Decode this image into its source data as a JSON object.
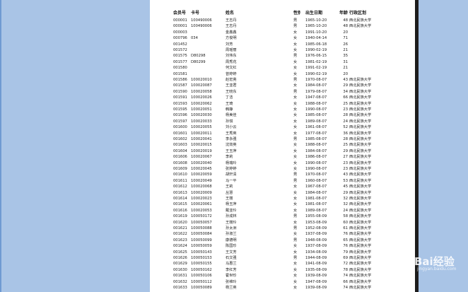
{
  "table": {
    "headers": {
      "id": "会员号",
      "card": "卡号",
      "name": "姓名",
      "gender": "性别",
      "dob": "出生日期",
      "age": "年龄",
      "division": "行政区划"
    },
    "rows": [
      {
        "id": "000001",
        "card": "100490006",
        "name": "王志丹",
        "gender": "男",
        "dob": "1965-10-20",
        "age": "48",
        "division": "西北民族大学"
      },
      {
        "id": "000001",
        "card": "100490006",
        "name": "王志丹",
        "gender": "男",
        "dob": "1965-10-20",
        "age": "48",
        "division": "西北民族大学"
      },
      {
        "id": "000003",
        "card": "",
        "name": "金鑫鑫",
        "gender": "女",
        "dob": "1991-10-20",
        "age": "20",
        "division": ""
      },
      {
        "id": "000796",
        "card": "034",
        "name": "方俊明",
        "gender": "女",
        "dob": "1940-04-14",
        "age": "71",
        "division": ""
      },
      {
        "id": "001452",
        "card": "",
        "name": "刘芳",
        "gender": "女",
        "dob": "1985-06-18",
        "age": "26",
        "division": ""
      },
      {
        "id": "001572",
        "card": "",
        "name": "周瑶丽",
        "gender": "女",
        "dob": "1990-02-19",
        "age": "21",
        "division": ""
      },
      {
        "id": "001575",
        "card": "D80298",
        "name": "刘伟东",
        "gender": "男",
        "dob": "1976-06-15",
        "age": "35",
        "division": ""
      },
      {
        "id": "001577",
        "card": "D80299",
        "name": "周秀花",
        "gender": "女",
        "dob": "1981-02-19",
        "age": "31",
        "division": ""
      },
      {
        "id": "001580",
        "card": "",
        "name": "何文红",
        "gender": "女",
        "dob": "1991-02-19",
        "age": "21",
        "division": ""
      },
      {
        "id": "001581",
        "card": "",
        "name": "曾婷婷",
        "gender": "女",
        "dob": "1990-02-19",
        "age": "20",
        "division": ""
      },
      {
        "id": "001586",
        "card": "100020010",
        "name": "赵宏亮",
        "gender": "男",
        "dob": "1970-08-07",
        "age": "43",
        "division": "西北民族大学"
      },
      {
        "id": "001587",
        "card": "100020087",
        "name": "王亚君",
        "gender": "女",
        "dob": "1984-08-07",
        "age": "29",
        "division": "西北民族大学"
      },
      {
        "id": "001590",
        "card": "100020058",
        "name": "王晓东",
        "gender": "男",
        "dob": "1979-08-07",
        "age": "34",
        "division": "西北民族大学"
      },
      {
        "id": "001591",
        "card": "100020026",
        "name": "丁洁",
        "gender": "女",
        "dob": "1947-08-07",
        "age": "66",
        "division": "西北民族大学"
      },
      {
        "id": "001593",
        "card": "100020062",
        "name": "王琦",
        "gender": "女",
        "dob": "1988-08-07",
        "age": "25",
        "division": "西北民族大学"
      },
      {
        "id": "001595",
        "card": "100020051",
        "name": "韩静",
        "gender": "女",
        "dob": "1990-08-07",
        "age": "23",
        "division": "西北民族大学"
      },
      {
        "id": "001596",
        "card": "100020030",
        "name": "杨美佳",
        "gender": "女",
        "dob": "1985-08-07",
        "age": "28",
        "division": "西北民族大学"
      },
      {
        "id": "001597",
        "card": "100020033",
        "name": "孙琪",
        "gender": "女",
        "dob": "1989-08-07",
        "age": "24",
        "division": "西北民族大学"
      },
      {
        "id": "001600",
        "card": "100020055",
        "name": "刘小云",
        "gender": "女",
        "dob": "1961-08-07",
        "age": "52",
        "division": "西北民族大学"
      },
      {
        "id": "001601",
        "card": "100020011",
        "name": "王秀英",
        "gender": "女",
        "dob": "1977-08-07",
        "age": "36",
        "division": "西北民族大学"
      },
      {
        "id": "001602",
        "card": "100020041",
        "name": "李永强",
        "gender": "男",
        "dob": "1985-08-07",
        "age": "28",
        "division": "西北民族大学"
      },
      {
        "id": "001603",
        "card": "100020015",
        "name": "沈效英",
        "gender": "女",
        "dob": "1988-08-07",
        "age": "25",
        "division": "西北民族大学"
      },
      {
        "id": "001604",
        "card": "100020019",
        "name": "王玉萍",
        "gender": "女",
        "dob": "1984-08-07",
        "age": "29",
        "division": "西北民族大学"
      },
      {
        "id": "001606",
        "card": "100020067",
        "name": "李莉",
        "gender": "女",
        "dob": "1986-08-07",
        "age": "27",
        "division": "西北民族大学"
      },
      {
        "id": "001608",
        "card": "100020040",
        "name": "杨瑞玲",
        "gender": "女",
        "dob": "1990-08-07",
        "age": "23",
        "division": "西北民族大学"
      },
      {
        "id": "001609",
        "card": "100020045",
        "name": "张婷婷",
        "gender": "女",
        "dob": "1990-08-07",
        "age": "23",
        "division": "西北民族大学"
      },
      {
        "id": "001610",
        "card": "100020059",
        "name": "胡轩清",
        "gender": "男",
        "dob": "1970-08-07",
        "age": "43",
        "division": "西北民族大学"
      },
      {
        "id": "001611",
        "card": "100020049",
        "name": "马一平",
        "gender": "男",
        "dob": "1960-08-07",
        "age": "53",
        "division": "西北民族大学"
      },
      {
        "id": "001612",
        "card": "100020068",
        "name": "王莉",
        "gender": "女",
        "dob": "1967-08-07",
        "age": "45",
        "division": "西北民族大学"
      },
      {
        "id": "001613",
        "card": "100020009",
        "name": "丛慧",
        "gender": "女",
        "dob": "1984-08-07",
        "age": "29",
        "division": "西北民族大学"
      },
      {
        "id": "001614",
        "card": "100020023",
        "name": "王丽",
        "gender": "女",
        "dob": "1981-08-07",
        "age": "32",
        "division": "西北民族大学"
      },
      {
        "id": "001615",
        "card": "100020061",
        "name": "杨玉萍",
        "gender": "女",
        "dob": "1981-08-07",
        "age": "32",
        "division": "西北民族大学"
      },
      {
        "id": "001616",
        "card": "100020053",
        "name": "戴亚玲",
        "gender": "女",
        "dob": "1989-08-07",
        "age": "24",
        "division": "西北民族大学"
      },
      {
        "id": "001619",
        "card": "100050172",
        "name": "孙成林",
        "gender": "男",
        "dob": "1955-08-09",
        "age": "58",
        "division": "西北民族大学"
      },
      {
        "id": "001620",
        "card": "100050057",
        "name": "王丽玲",
        "gender": "女",
        "dob": "1953-08-09",
        "age": "60",
        "division": "西北民族大学"
      },
      {
        "id": "001621",
        "card": "100050088",
        "name": "孙太洲",
        "gender": "男",
        "dob": "1952-08-09",
        "age": "61",
        "division": "西北民族大学"
      },
      {
        "id": "001622",
        "card": "100050084",
        "name": "孙淑兰",
        "gender": "女",
        "dob": "1937-08-09",
        "age": "76",
        "division": "西北民族大学"
      },
      {
        "id": "001623",
        "card": "100050099",
        "name": "康德明",
        "gender": "男",
        "dob": "1948-08-09",
        "age": "65",
        "division": "西北民族大学"
      },
      {
        "id": "001624",
        "card": "100050059",
        "name": "陈国珍",
        "gender": "女",
        "dob": "1937-08-09",
        "age": "76",
        "division": "西北民族大学"
      },
      {
        "id": "001625",
        "card": "100050143",
        "name": "王文芳",
        "gender": "女",
        "dob": "1934-08-09",
        "age": "79",
        "division": "西北民族大学"
      },
      {
        "id": "001626",
        "card": "100050153",
        "name": "石文强",
        "gender": "男",
        "dob": "1944-08-09",
        "age": "69",
        "division": "西北民族大学"
      },
      {
        "id": "001629",
        "card": "100050155",
        "name": "马惠兰",
        "gender": "女",
        "dob": "1941-08-09",
        "age": "72",
        "division": "西北民族大学"
      },
      {
        "id": "001630",
        "card": "100050162",
        "name": "李红芳",
        "gender": "女",
        "dob": "1935-08-09",
        "age": "78",
        "division": "西北民族大学"
      },
      {
        "id": "001631",
        "card": "100050106",
        "name": "霍世珍",
        "gender": "女",
        "dob": "1939-08-09",
        "age": "74",
        "division": "西北民族大学"
      },
      {
        "id": "001632",
        "card": "100050112",
        "name": "张维玲",
        "gender": "女",
        "dob": "1947-08-09",
        "age": "66",
        "division": "西北民族大学"
      },
      {
        "id": "001633",
        "card": "100050089",
        "name": "杨兰英",
        "gender": "女",
        "dob": "1939-08-09",
        "age": "74",
        "division": "西北民族大学"
      }
    ]
  },
  "watermark": {
    "brand": "Bai经验",
    "sub": "jingyan.baidu.com"
  }
}
